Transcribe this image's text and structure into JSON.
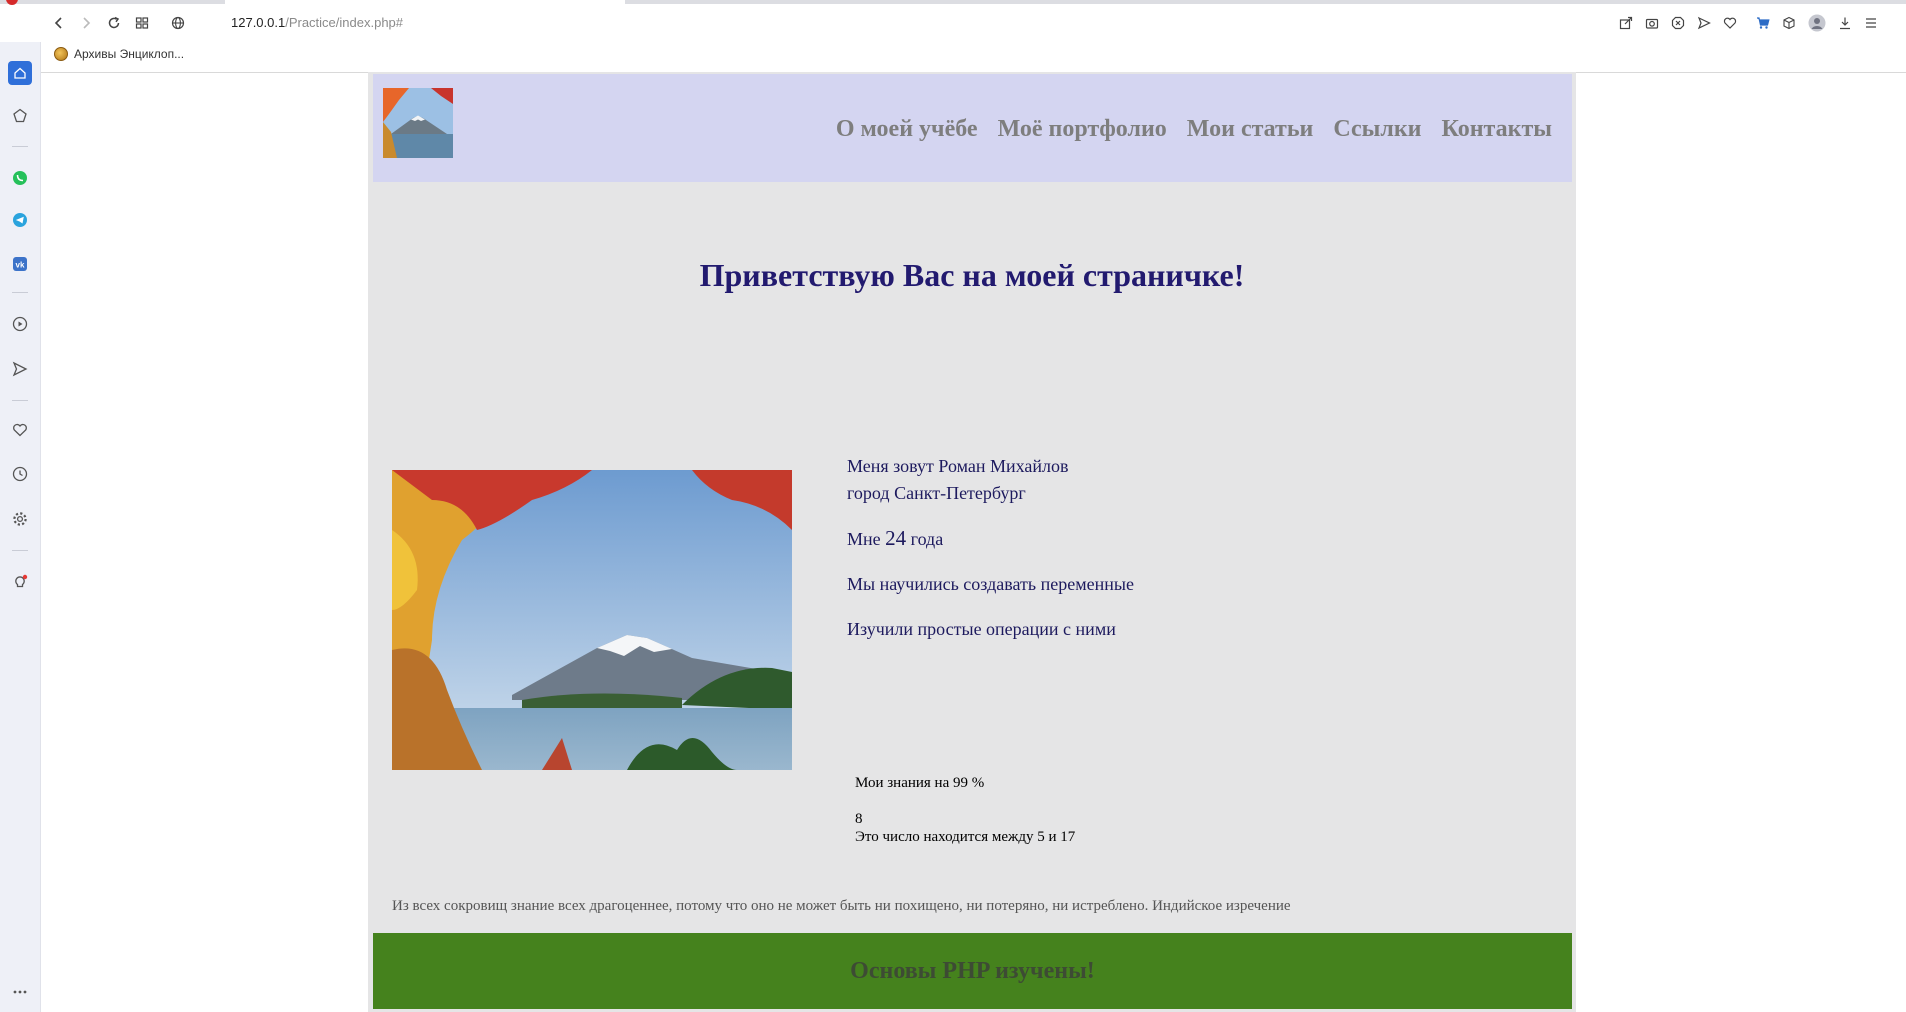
{
  "browser": {
    "url_host": "127.0.0.1",
    "url_path": "/Practice/index.php#",
    "bookmark_label": "Архивы Энциклоп..."
  },
  "page": {
    "nav": [
      {
        "label": "О моей учёбе"
      },
      {
        "label": "Моё портфолио"
      },
      {
        "label": "Мои статьи"
      },
      {
        "label": "Ссылки"
      },
      {
        "label": "Контакты"
      }
    ],
    "greeting": "Приветствую Вас на моей страничке!",
    "name_line": "Меня зовут Роман Михайлов",
    "city_line": "город Санкт-Петербург",
    "age_prefix": "Мне",
    "age_number": "24",
    "age_suffix": "года",
    "line_vars": "Мы научились создавать переменные",
    "line_ops": "Изучили простые операции с ними",
    "knowledge": "Мои знания на 99 %",
    "number": "8",
    "number_range": "Это число находится между 5 и 17",
    "quote": "Из всех сокровищ знание всех драгоценнее, потому что оно не может быть ни похищено, ни потеряно, ни истреблено. Индийское изречение",
    "footer": "Основы PHP изучены!"
  },
  "colors": {
    "header_bg": "#d4d5f1",
    "page_bg": "#e5e5e6",
    "footer_bg": "#45821d",
    "heading": "#221a6f",
    "nav_text": "#7e7e7e"
  }
}
